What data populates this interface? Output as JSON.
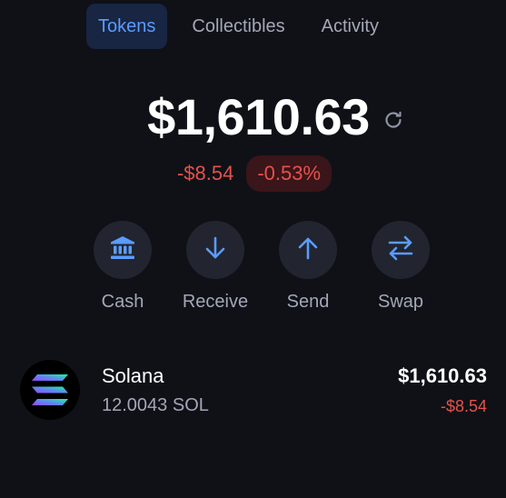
{
  "tabs": [
    {
      "label": "Tokens",
      "active": true
    },
    {
      "label": "Collectibles",
      "active": false
    },
    {
      "label": "Activity",
      "active": false
    }
  ],
  "balance": {
    "total": "$1,610.63",
    "change_abs": "-$8.54",
    "change_pct": "-0.53%",
    "refresh_icon": "refresh-icon"
  },
  "actions": [
    {
      "label": "Cash",
      "icon": "bank-icon"
    },
    {
      "label": "Receive",
      "icon": "arrow-down-icon"
    },
    {
      "label": "Send",
      "icon": "arrow-up-icon"
    },
    {
      "label": "Swap",
      "icon": "swap-icon"
    }
  ],
  "tokens": [
    {
      "name": "Solana",
      "amount": "12.0043 SOL",
      "value": "$1,610.63",
      "change": "-$8.54",
      "logo": "solana-logo-icon"
    }
  ],
  "colors": {
    "background": "#0f1117",
    "accent": "#5a9cff",
    "negative": "#e5524b",
    "muted_text": "#a3a7b7",
    "button_bg": "#22252f"
  }
}
